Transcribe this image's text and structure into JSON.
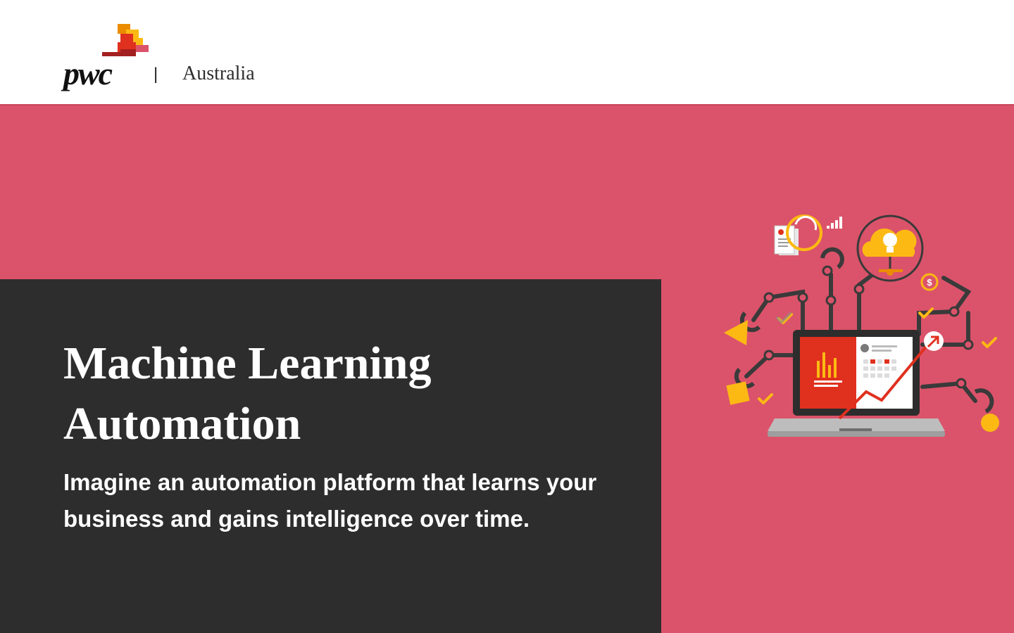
{
  "header": {
    "brand_name": "pwc",
    "separator": "|",
    "region": "Australia",
    "logo_colors": [
      "#fdb913",
      "#eb8c00",
      "#e0301e",
      "#db536a",
      "#a32020"
    ]
  },
  "hero": {
    "title_line1": "Machine Learning",
    "title_line2": "Automation",
    "subtitle": "Imagine an automation platform that learns your business and gains intelligence over time.",
    "background_color": "#db536a",
    "panel_color": "#2d2d2d"
  },
  "illustration": {
    "icons": [
      "laptop-icon",
      "bar-chart-icon",
      "calendar-icon",
      "trend-arrow-icon",
      "lightbulb-cloud-icon",
      "document-icon",
      "signal-icon",
      "dollar-icon",
      "checkmark-icon",
      "triangle-icon",
      "square-icon",
      "circle-icon",
      "robot-arm-icon"
    ],
    "dollar_symbol": "$"
  }
}
